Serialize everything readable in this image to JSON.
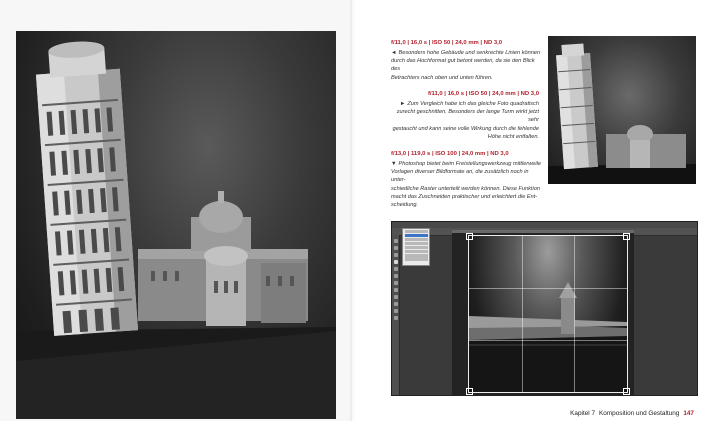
{
  "captions": [
    {
      "heading": "f/11,0 | 16,0 s | ISO 50 | 24,0 mm | ND 3,0",
      "arrow": "◄",
      "lines": [
        "Besonders hohe Gebäude und senkrechte Linien können",
        "durch das Hochformat gut betont werden, da sie den Blick des",
        "Betrachters nach oben und unten führen."
      ]
    },
    {
      "heading": "f/11,0 | 16,0 s | ISO 50 | 24,0 mm | ND 3,0",
      "arrow": "►",
      "lines": [
        "Zum Vergleich habe ich das gleiche Foto quadratisch",
        "zurecht geschnitten. Besonders der lange Turm wirkt jetzt sehr",
        "gestaucht und kann seine volle Wirkung durch die fehlende",
        "Höhe nicht entfalten."
      ]
    },
    {
      "heading": "f/13,0 | 119,0 s | ISO 100 | 24,0 mm | ND 3,0",
      "arrow": "▼",
      "lines": [
        "Photoshop bietet beim Freistellungswerkzeug mittlerweile",
        "Vorlagen diverser Bildformate an, die zusätzlich noch in unter-",
        "schiedliche Raster unterteilt werden können. Diese Funktion",
        "macht das Zuschneiden praktischer und erleichtert die Ent-",
        "scheidung."
      ]
    }
  ],
  "footer": {
    "chapter": "Kapitel 7",
    "title": "Komposition und Gestaltung",
    "page": "147"
  },
  "images": {
    "large_photo": "leaning-tower-portrait-photo",
    "small_photo": "leaning-tower-square-photo",
    "screenshot": "photoshop-crop-tool-screenshot"
  }
}
